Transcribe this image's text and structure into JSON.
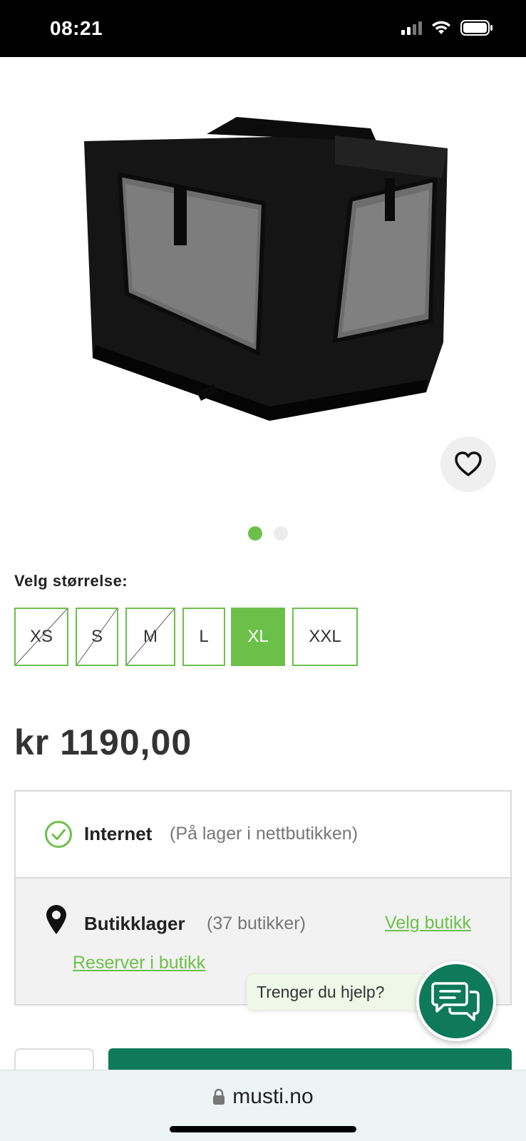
{
  "status_bar": {
    "time": "08:21"
  },
  "product": {
    "image_alt": "",
    "carousel": {
      "total": 2,
      "active_index": 0
    }
  },
  "size_selector": {
    "label": "Velg størrelse:",
    "options": [
      {
        "label": "XS",
        "available": false,
        "selected": false
      },
      {
        "label": "S",
        "available": false,
        "selected": false
      },
      {
        "label": "M",
        "available": false,
        "selected": false
      },
      {
        "label": "L",
        "available": true,
        "selected": false
      },
      {
        "label": "XL",
        "available": true,
        "selected": true
      },
      {
        "label": "XXL",
        "available": true,
        "selected": false
      }
    ]
  },
  "price": "kr 1190,00",
  "availability": {
    "internet_title": "Internet",
    "internet_note": "(På lager i nettbutikken)",
    "store_title": "Butikklager",
    "store_count": "(37 butikker)",
    "choose_store": "Velg butikk",
    "reserve": "Reserver i butikk"
  },
  "help": {
    "bubble": "Trenger du hjelp?"
  },
  "browser": {
    "url": "musti.no"
  },
  "colors": {
    "accent": "#6cc04a",
    "dark_green": "#0f7a5a"
  },
  "icons": {
    "favorite": "heart-icon",
    "compare": "compare-arrows-icon",
    "internet": "check-circle-icon",
    "store": "location-pin-icon",
    "chat": "chat-bubbles-icon",
    "lock": "lock-icon"
  }
}
